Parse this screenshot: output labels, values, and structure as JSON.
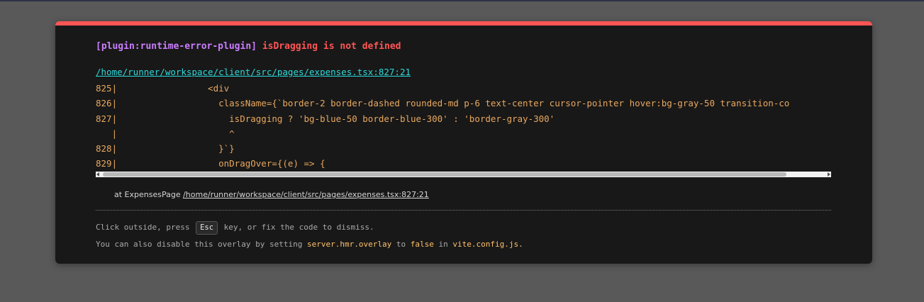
{
  "overlay": {
    "plugin": "[plugin:runtime-error-plugin]",
    "message": "isDragging is not defined",
    "file": "/home/runner/workspace/client/src/pages/expenses.tsx:827:21",
    "frame": [
      "825|                 <div",
      "826|                   className={`border-2 border-dashed rounded-md p-6 text-center cursor-pointer hover:bg-gray-50 transition-co",
      "827|                     isDragging ? 'bg-blue-50 border-blue-300' : 'border-gray-300'",
      "   |                     ^",
      "828|                   }`}",
      "829|                   onDragOver={(e) => {"
    ],
    "stack": {
      "prefix": "at ExpensesPage",
      "link": "/home/runner/workspace/client/src/pages/expenses.tsx:827:21"
    },
    "tip": {
      "line1_before": "Click outside, press",
      "key": "Esc",
      "line1_after": "key, or fix the code to dismiss.",
      "line2_a": "You can also disable this overlay by setting",
      "line2_code1": "server.hmr.overlay",
      "line2_b": "to",
      "line2_code2": "false",
      "line2_c": "in",
      "line2_code3": "vite.config.js."
    },
    "colors": {
      "accent_top": "#ff5555",
      "plugin": "#cb7eff",
      "error": "#ff5555",
      "link": "#2dd9da",
      "code": "#e8a860",
      "highlight": "#ffc06b"
    }
  }
}
